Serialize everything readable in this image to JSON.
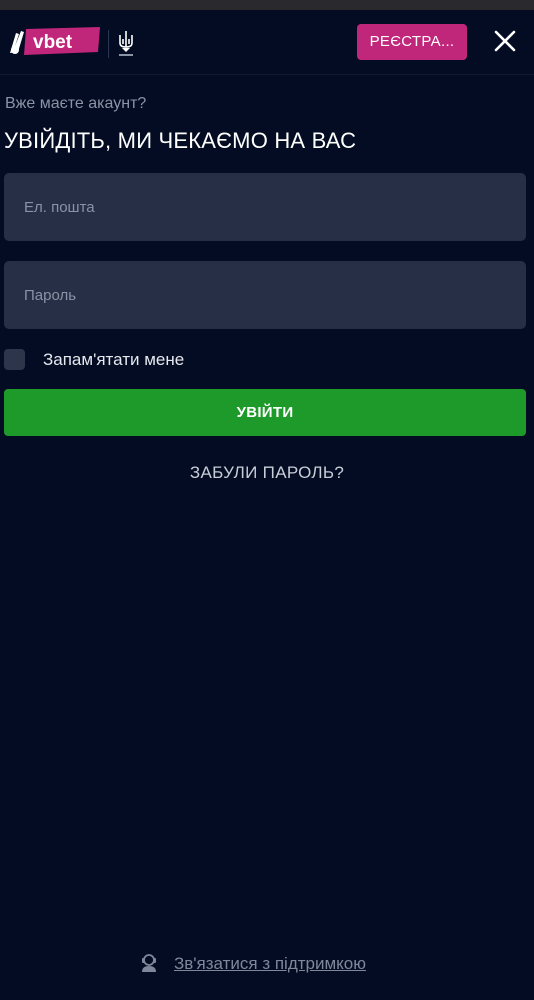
{
  "header": {
    "logo_text": "vbet",
    "register_label": "РЕЄСТРА...",
    "close_label": "close"
  },
  "login": {
    "subtitle": "Вже маєте акаунт?",
    "title": "УВІЙДІТЬ, МИ ЧЕКАЄМО НА ВАС",
    "email_placeholder": "Ел. пошта",
    "email_value": "",
    "password_placeholder": "Пароль",
    "password_value": "",
    "remember_label": "Запам'ятати мене",
    "remember_checked": false,
    "submit_label": "УВІЙТИ",
    "forgot_label": "ЗАБУЛИ ПАРОЛЬ?"
  },
  "footer": {
    "support_label": "Зв'язатися з підтримкою"
  },
  "colors": {
    "background": "#030c22",
    "register_button": "#c0267a",
    "login_button": "#1d9a2a",
    "input_background": "#262f45"
  },
  "icons": {
    "logo": "vbet-logo",
    "emblem": "trident-emblem-icon",
    "close": "close-icon",
    "support": "support-agent-icon"
  }
}
